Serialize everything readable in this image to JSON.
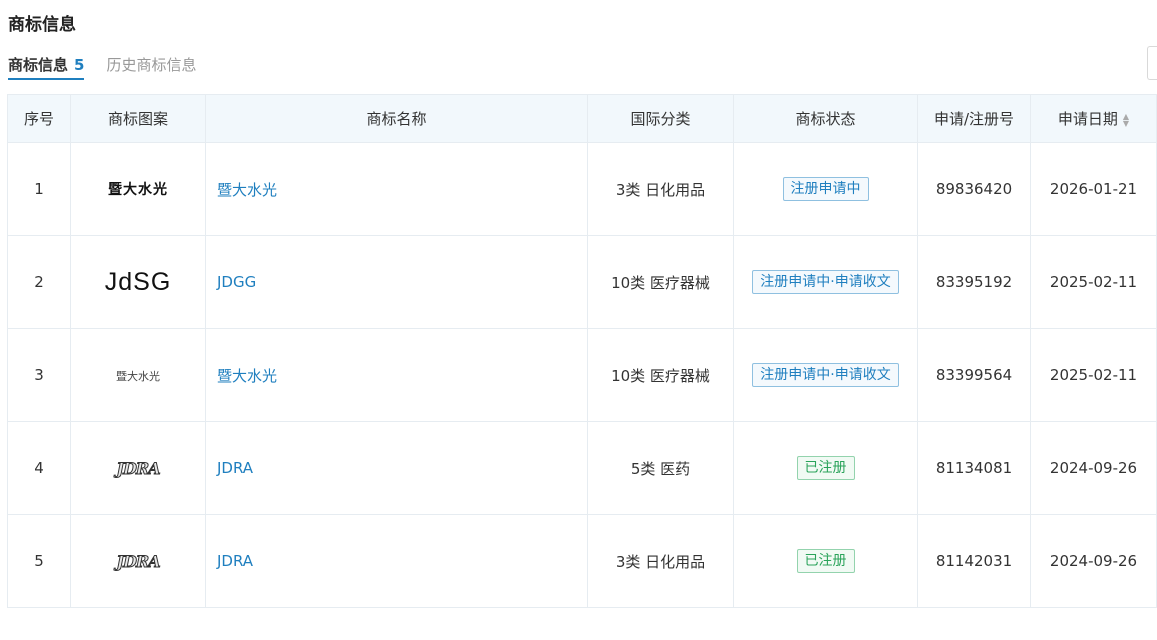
{
  "section_title": "商标信息",
  "tabs": [
    {
      "label": "商标信息",
      "count": "5",
      "active": true
    },
    {
      "label": "历史商标信息",
      "active": false
    }
  ],
  "table": {
    "headers": [
      "序号",
      "商标图案",
      "商标名称",
      "国际分类",
      "商标状态",
      "申请/注册号",
      "申请日期"
    ],
    "rows": [
      {
        "index": "1",
        "logo_text": "暨大水光",
        "name": "暨大水光",
        "class": "3类 日化用品",
        "status": "注册申请中",
        "status_color": "blue",
        "reg_no": "89836420",
        "date": "2026-01-21"
      },
      {
        "index": "2",
        "logo_text": "JdSG",
        "name": "JDGG",
        "class": "10类 医疗器械",
        "status": "注册申请中·申请收文",
        "status_color": "blue",
        "reg_no": "83395192",
        "date": "2025-02-11"
      },
      {
        "index": "3",
        "logo_text": "暨大水光",
        "name": "暨大水光",
        "class": "10类 医疗器械",
        "status": "注册申请中·申请收文",
        "status_color": "blue",
        "reg_no": "83399564",
        "date": "2025-02-11"
      },
      {
        "index": "4",
        "logo_text": "JDRA",
        "name": "JDRA",
        "class": "5类 医药",
        "status": "已注册",
        "status_color": "green",
        "reg_no": "81134081",
        "date": "2024-09-26"
      },
      {
        "index": "5",
        "logo_text": "JDRA",
        "name": "JDRA",
        "class": "3类 日化用品",
        "status": "已注册",
        "status_color": "green",
        "reg_no": "81142031",
        "date": "2024-09-26"
      }
    ]
  },
  "colors": {
    "accent": "#1f7fbf",
    "header_bg": "#f2f8fc",
    "status_blue": "#1f7fbf",
    "status_green": "#2aa35a"
  },
  "icons": {
    "sort": "sort-caret-icon"
  }
}
